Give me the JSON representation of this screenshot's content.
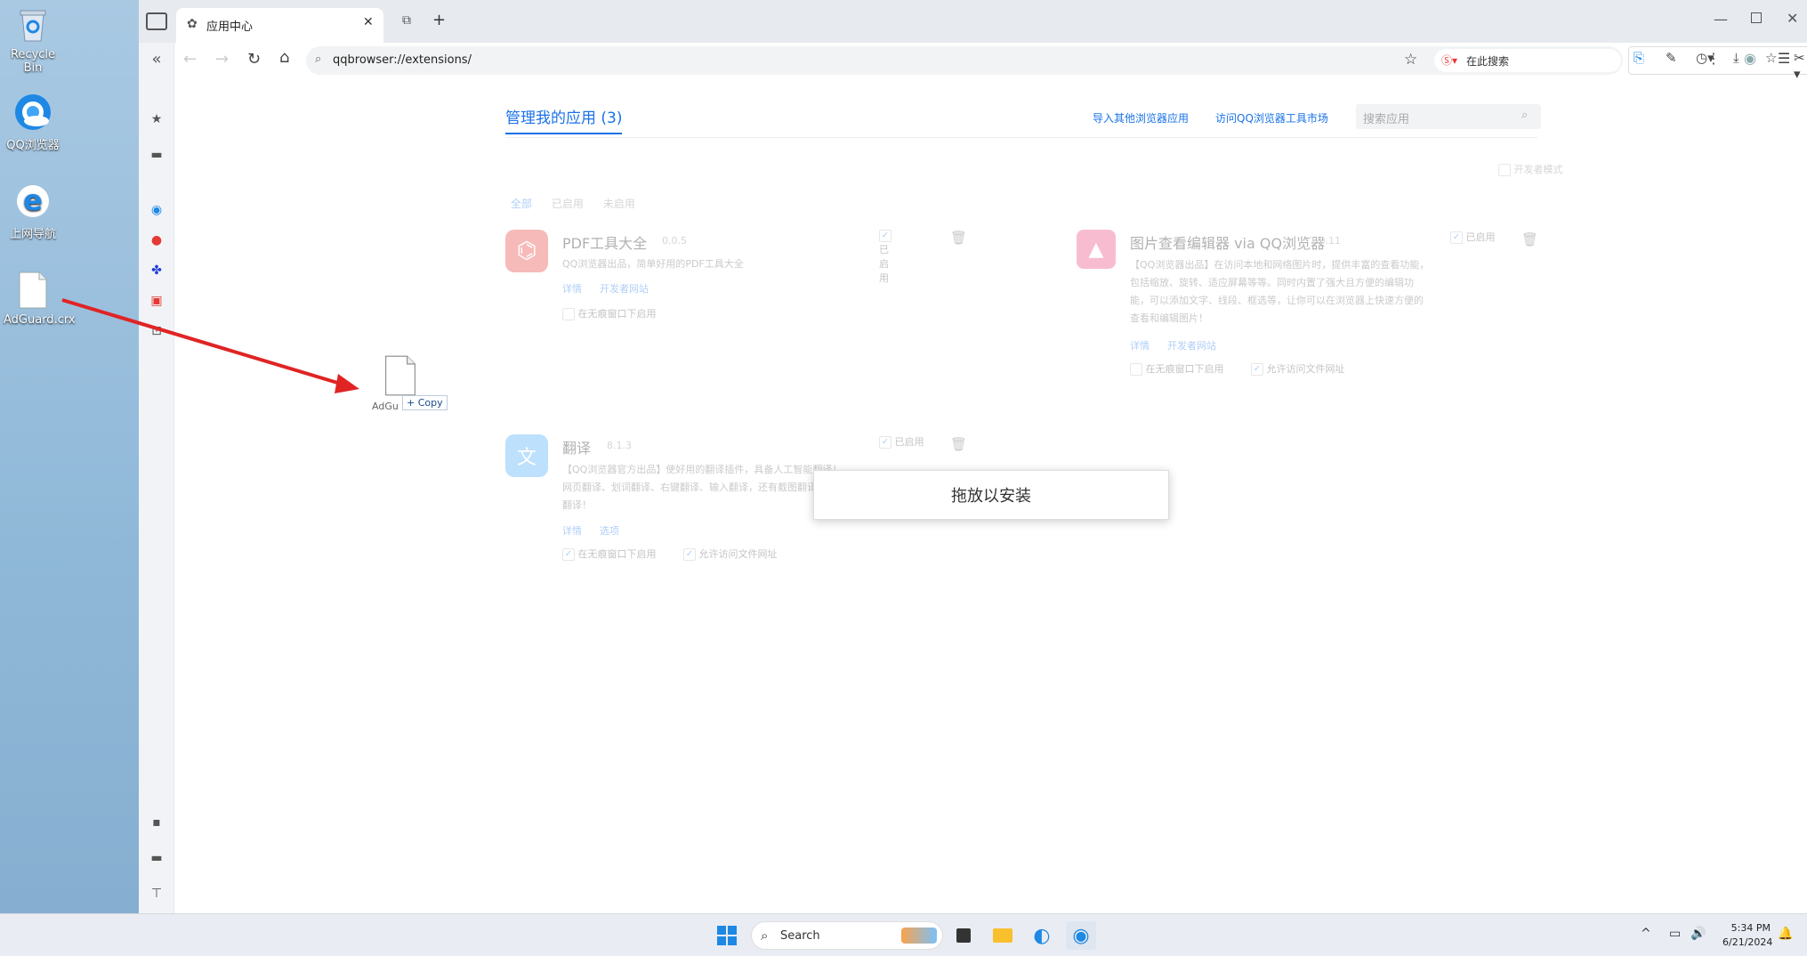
{
  "desktop": {
    "icons": [
      {
        "label": "Recycle Bin",
        "icon": "recycle-bin-icon"
      },
      {
        "label": "QQ浏览器",
        "icon": "qq-browser-icon"
      },
      {
        "label": "上网导航",
        "icon": "ie-icon"
      },
      {
        "label": "AdGuard.crx",
        "icon": "file-icon"
      }
    ],
    "drag_label": "AdGu",
    "drag_copy": "+ Copy"
  },
  "browser": {
    "tab_title": "应用中心",
    "address": "qqbrowser://extensions/",
    "search_placeholder": "在此搜索"
  },
  "page": {
    "title": "管理我的应用 (3)",
    "import_link": "导入其他浏览器应用",
    "store_link": "访问QQ浏览器工具市场",
    "search_placeholder": "搜索应用",
    "dev_mode": "开发者模式",
    "filters": [
      "全部",
      "已启用",
      "未启用"
    ],
    "extensions": [
      {
        "name": "PDF工具大全",
        "version": "0.0.5",
        "desc": "QQ浏览器出品，简单好用的PDF工具大全",
        "links": [
          "详情",
          "开发者网站"
        ],
        "enabled_label": "已启用",
        "options": [
          "在无痕窗口下启用"
        ]
      },
      {
        "name": "图片查看编辑器 via QQ浏览器",
        "version": "1.0.11",
        "desc": "【QQ浏览器出品】在访问本地和网络图片时，提供丰富的查看功能，包括缩放、旋转、适应屏幕等等。同时内置了强大且方便的编辑功能，可以添加文字、线段、框选等，让你可以在浏览器上快速方便的查看和编辑图片！",
        "links": [
          "详情",
          "开发者网站"
        ],
        "enabled_label": "已启用",
        "options": [
          "在无痕窗口下启用",
          "允许访问文件网址"
        ]
      },
      {
        "name": "翻译",
        "version": "8.1.3",
        "desc": "【QQ浏览器官方出品】使好用的翻译插件，具备人工智能翻译！网页翻译、划词翻译、右键翻译、输入翻译，还有截图翻译，文档翻译！",
        "links": [
          "详情",
          "选项"
        ],
        "enabled_label": "已启用",
        "options": [
          "在无痕窗口下启用",
          "允许访问文件网址"
        ]
      }
    ],
    "drop_text": "拖放以安装"
  },
  "taskbar": {
    "search": "Search",
    "time": "5:34 PM",
    "date": "6/21/2024"
  },
  "colors": {
    "accent": "#1a73e8",
    "arrow": "#e02424"
  }
}
